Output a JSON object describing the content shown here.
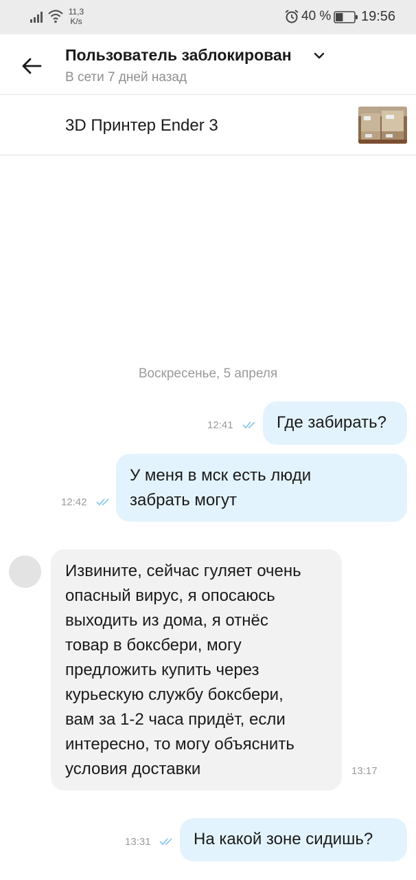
{
  "status_bar": {
    "net_speed_value": "11,3",
    "net_speed_unit": "K/s",
    "battery_percent": "40 %",
    "battery_level": 0.4,
    "time": "19:56",
    "icons": [
      "signal-icon",
      "wifi-icon",
      "alarm-icon",
      "battery-icon"
    ]
  },
  "header": {
    "title": "Пользователь заблокирован",
    "subtitle": "В сети 7 дней назад",
    "icons": [
      "back-arrow-icon",
      "chevron-down-icon"
    ]
  },
  "item": {
    "title": "3D Принтер Ender 3"
  },
  "chat": {
    "date_separator": "Воскресенье, 5 апреля",
    "messages": [
      {
        "direction": "out",
        "text": "Где забирать?",
        "time": "12:41",
        "read": true
      },
      {
        "direction": "out",
        "text_lines": [
          "У меня в мск есть люди",
          "забрать могут"
        ],
        "time": "12:42",
        "read": true
      },
      {
        "direction": "in",
        "text_lines": [
          "Извините, сейчас гуляет очень",
          "опасный вирус, я опосаюсь",
          "выходить из дома, я отнёс",
          "товар в боксбери, могу",
          "предложить купить через",
          "курьескую службу боксбери,",
          "вам за 1-2 часа придёт, если",
          "интересно, то могу объяснить",
          "условия доставки"
        ],
        "time": "13:17"
      },
      {
        "direction": "out",
        "text": "На какой зоне сидишь?",
        "time": "13:31",
        "read": true
      }
    ]
  },
  "colors": {
    "outgoing_bubble": "#e3f3fd",
    "incoming_bubble": "#f2f2f2",
    "read_ticks": "#8cc8ef",
    "status_bar_bg": "#ececec"
  }
}
